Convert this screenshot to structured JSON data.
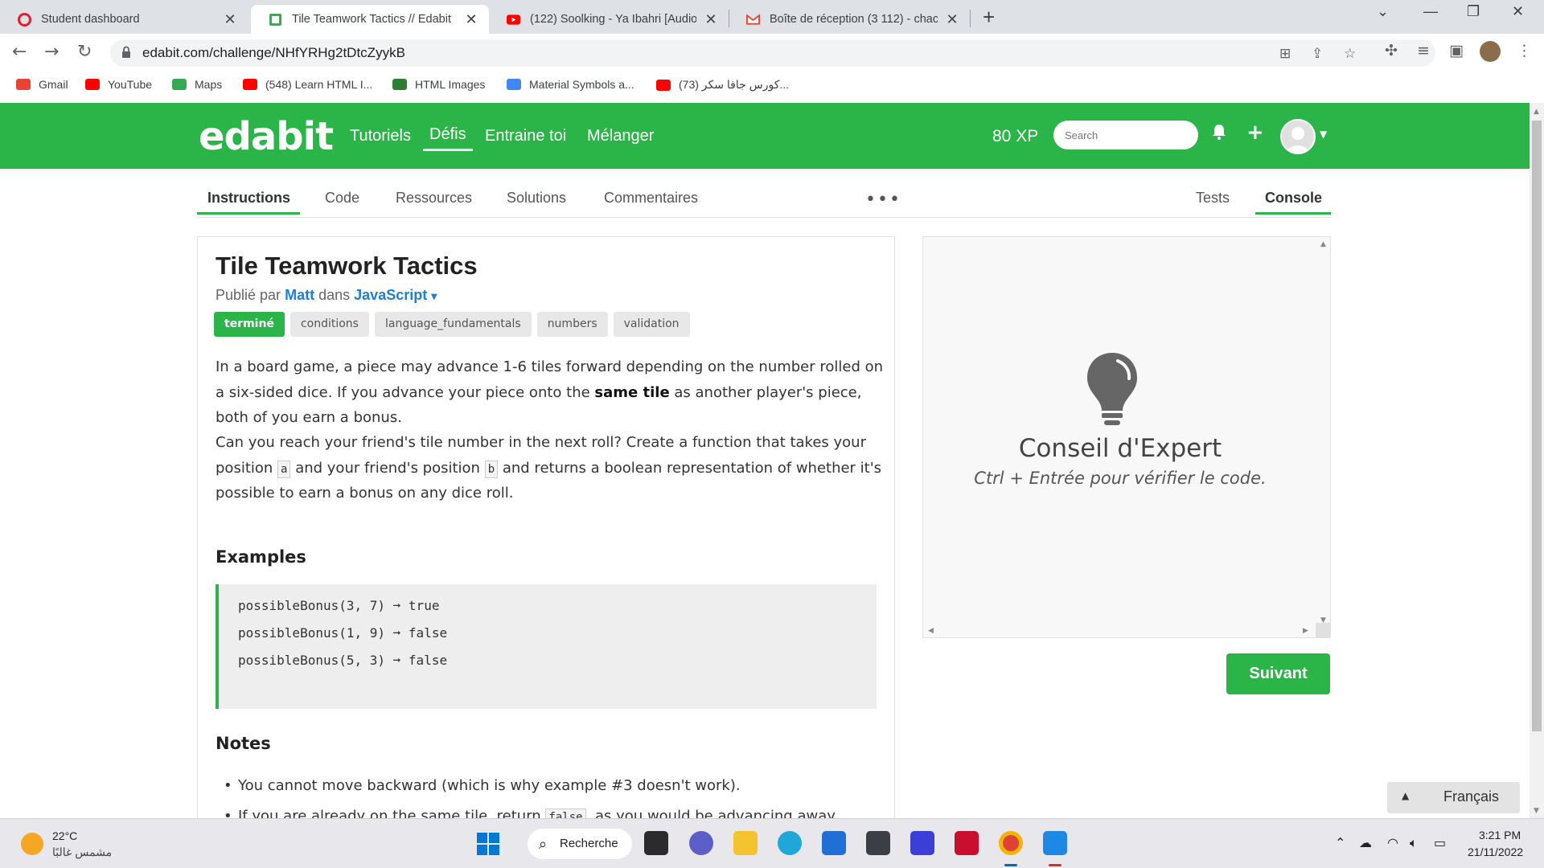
{
  "browser": {
    "tabs": [
      {
        "title": "Student dashboard"
      },
      {
        "title": "Tile Teamwork Tactics // Edabit"
      },
      {
        "title": "(122) Soolking - Ya Ibahri [Audio"
      },
      {
        "title": "Boîte de réception (3 112) - chac"
      }
    ],
    "close_glyph": "✕",
    "new_tab_glyph": "+",
    "url": "edabit.com/challenge/NHfYRHg2tDtcZyykB",
    "bookmarks": [
      {
        "label": "Gmail",
        "color": "#ea4335"
      },
      {
        "label": "YouTube",
        "color": "#ff0000"
      },
      {
        "label": "Maps",
        "color": "#34a853"
      },
      {
        "label": "(548) Learn HTML I...",
        "color": "#ff0000"
      },
      {
        "label": "HTML Images",
        "color": "#2e7d32"
      },
      {
        "label": "Material Symbols a...",
        "color": "#4285f4"
      },
      {
        "label": "(73) كورس جافا سكر...",
        "color": "#ff0000"
      }
    ]
  },
  "site": {
    "logo": "edabit",
    "nav": [
      "Tutoriels",
      "Défis",
      "Entraine toi",
      "Mélanger"
    ],
    "xp": "80 XP",
    "search_placeholder": "Search",
    "accent": "#2bb548"
  },
  "subnav": {
    "left": [
      "Instructions",
      "Code",
      "Ressources",
      "Solutions",
      "Commentaires"
    ],
    "more": "•••",
    "right": [
      "Tests",
      "Console"
    ]
  },
  "challenge": {
    "title": "Tile Teamwork Tactics",
    "published_by": "Publié par",
    "author": "Matt",
    "in_word": "dans",
    "language": "JavaScript",
    "language_caret": "▾",
    "tags": [
      "terminé",
      "conditions",
      "language_fundamentals",
      "numbers",
      "validation"
    ],
    "p1_before": "In a board game, a piece may advance 1-6 tiles forward depending on the number rolled on a six-sided dice. If you advance your piece onto the ",
    "p1_bold": "same tile",
    "p1_after": " as another player's piece, both of you earn a bonus.",
    "p2_a": "Can you reach your friend's tile number in the next roll? Create a function that takes your position ",
    "p2_code1": "a",
    "p2_b": " and your friend's position ",
    "p2_code2": "b",
    "p2_c": " and returns a boolean representation of whether it's possible to earn a bonus on any dice roll.",
    "examples_heading": "Examples",
    "examples": [
      "possibleBonus(3, 7) ➞ true",
      "possibleBonus(1, 9) ➞ false",
      "possibleBonus(5, 3) ➞ false"
    ],
    "notes_heading": "Notes",
    "note1": "You cannot move backward (which is why example #3 doesn't work).",
    "note2_a": "If you are already on the same tile, return ",
    "note2_code": "false",
    "note2_b": ", as you would be advancing away."
  },
  "console": {
    "tip_title": "Conseil d'Expert",
    "tip_sub": "Ctrl + Entrée pour vérifier le code."
  },
  "next_button": "Suivant",
  "language_selector": "Français",
  "taskbar": {
    "temperature": "22°C",
    "weather": "مشمس غالبًا",
    "search_label": "Recherche",
    "time": "3:21 PM",
    "date": "21/11/2022"
  }
}
